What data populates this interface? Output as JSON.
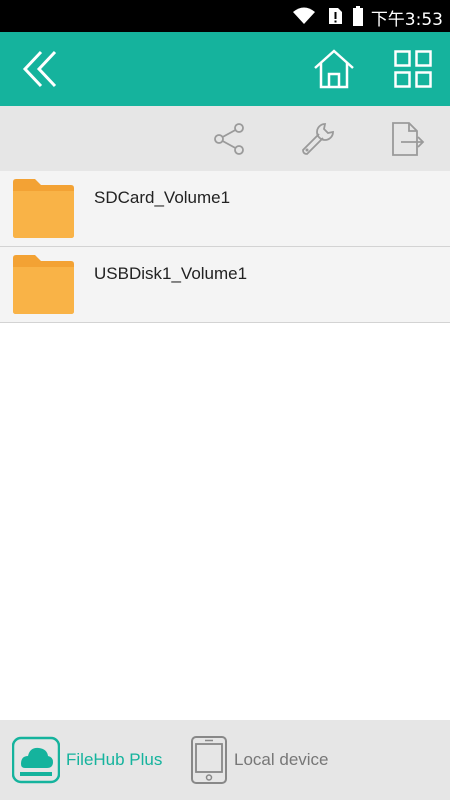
{
  "status": {
    "time": "下午3:53",
    "icons": [
      "wifi-icon",
      "sim-alert-icon",
      "battery-icon"
    ]
  },
  "header": {
    "back_icon": "double-chevron-left-icon",
    "home_icon": "home-icon",
    "grid_icon": "grid-view-icon"
  },
  "toolbar": {
    "icons": [
      "share-icon",
      "wrench-icon",
      "export-icon"
    ]
  },
  "files": [
    {
      "name": "SDCard_Volume1",
      "icon": "folder-icon"
    },
    {
      "name": "USBDisk1_Volume1",
      "icon": "folder-icon"
    }
  ],
  "bottom_tabs": [
    {
      "label": "FileHub Plus",
      "icon": "cloud-drive-icon",
      "active": true
    },
    {
      "label": "Local device",
      "icon": "phone-icon",
      "active": false
    }
  ],
  "colors": {
    "accent": "#15b39d",
    "folder": "#f7a93b",
    "toolbar_bg": "#e6e6e6",
    "inactive_text": "#777777"
  }
}
